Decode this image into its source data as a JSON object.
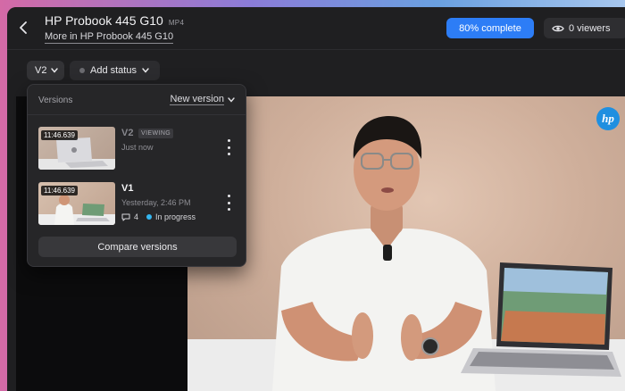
{
  "header": {
    "title": "HP Probook 445 G10",
    "format": "MP4",
    "breadcrumb": "More in HP Probook 445 G10",
    "progress_label": "80% complete",
    "progress_fraction": 0.8,
    "viewers_label": "0 viewers",
    "accent_color": "#2d7df6"
  },
  "toolbar": {
    "version_label": "V2",
    "status_label": "Add status"
  },
  "versions_popover": {
    "title": "Versions",
    "new_version_label": "New version",
    "items": [
      {
        "timecode": "11:46.639",
        "label": "V2",
        "badge": "VIEWING",
        "subtitle": "Just now"
      },
      {
        "timecode": "11:46.639",
        "label": "V1",
        "subtitle": "Yesterday, 2:46 PM",
        "comment_count": "4",
        "status": "In progress",
        "status_color": "#34b6f0"
      }
    ],
    "compare_label": "Compare versions"
  },
  "icons": [
    "chevron-left-icon",
    "eye-icon",
    "chevron-down-icon",
    "comment-icon",
    "more-vertical-icon",
    "hp-logo"
  ]
}
